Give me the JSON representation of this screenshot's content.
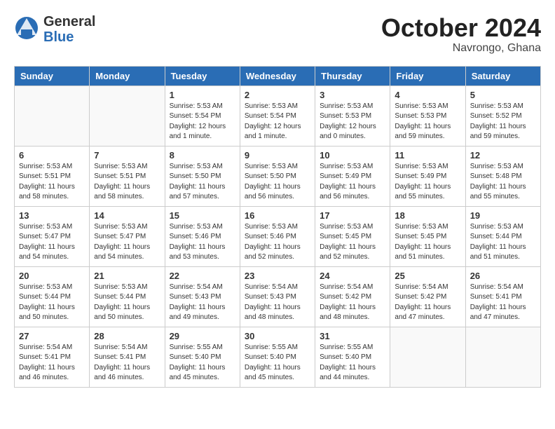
{
  "header": {
    "logo_general": "General",
    "logo_blue": "Blue",
    "month_title": "October 2024",
    "location": "Navrongo, Ghana"
  },
  "weekdays": [
    "Sunday",
    "Monday",
    "Tuesday",
    "Wednesday",
    "Thursday",
    "Friday",
    "Saturday"
  ],
  "weeks": [
    [
      {
        "day": "",
        "info": ""
      },
      {
        "day": "",
        "info": ""
      },
      {
        "day": "1",
        "info": "Sunrise: 5:53 AM\nSunset: 5:54 PM\nDaylight: 12 hours\nand 1 minute."
      },
      {
        "day": "2",
        "info": "Sunrise: 5:53 AM\nSunset: 5:54 PM\nDaylight: 12 hours\nand 1 minute."
      },
      {
        "day": "3",
        "info": "Sunrise: 5:53 AM\nSunset: 5:53 PM\nDaylight: 12 hours\nand 0 minutes."
      },
      {
        "day": "4",
        "info": "Sunrise: 5:53 AM\nSunset: 5:53 PM\nDaylight: 11 hours\nand 59 minutes."
      },
      {
        "day": "5",
        "info": "Sunrise: 5:53 AM\nSunset: 5:52 PM\nDaylight: 11 hours\nand 59 minutes."
      }
    ],
    [
      {
        "day": "6",
        "info": "Sunrise: 5:53 AM\nSunset: 5:51 PM\nDaylight: 11 hours\nand 58 minutes."
      },
      {
        "day": "7",
        "info": "Sunrise: 5:53 AM\nSunset: 5:51 PM\nDaylight: 11 hours\nand 58 minutes."
      },
      {
        "day": "8",
        "info": "Sunrise: 5:53 AM\nSunset: 5:50 PM\nDaylight: 11 hours\nand 57 minutes."
      },
      {
        "day": "9",
        "info": "Sunrise: 5:53 AM\nSunset: 5:50 PM\nDaylight: 11 hours\nand 56 minutes."
      },
      {
        "day": "10",
        "info": "Sunrise: 5:53 AM\nSunset: 5:49 PM\nDaylight: 11 hours\nand 56 minutes."
      },
      {
        "day": "11",
        "info": "Sunrise: 5:53 AM\nSunset: 5:49 PM\nDaylight: 11 hours\nand 55 minutes."
      },
      {
        "day": "12",
        "info": "Sunrise: 5:53 AM\nSunset: 5:48 PM\nDaylight: 11 hours\nand 55 minutes."
      }
    ],
    [
      {
        "day": "13",
        "info": "Sunrise: 5:53 AM\nSunset: 5:47 PM\nDaylight: 11 hours\nand 54 minutes."
      },
      {
        "day": "14",
        "info": "Sunrise: 5:53 AM\nSunset: 5:47 PM\nDaylight: 11 hours\nand 54 minutes."
      },
      {
        "day": "15",
        "info": "Sunrise: 5:53 AM\nSunset: 5:46 PM\nDaylight: 11 hours\nand 53 minutes."
      },
      {
        "day": "16",
        "info": "Sunrise: 5:53 AM\nSunset: 5:46 PM\nDaylight: 11 hours\nand 52 minutes."
      },
      {
        "day": "17",
        "info": "Sunrise: 5:53 AM\nSunset: 5:45 PM\nDaylight: 11 hours\nand 52 minutes."
      },
      {
        "day": "18",
        "info": "Sunrise: 5:53 AM\nSunset: 5:45 PM\nDaylight: 11 hours\nand 51 minutes."
      },
      {
        "day": "19",
        "info": "Sunrise: 5:53 AM\nSunset: 5:44 PM\nDaylight: 11 hours\nand 51 minutes."
      }
    ],
    [
      {
        "day": "20",
        "info": "Sunrise: 5:53 AM\nSunset: 5:44 PM\nDaylight: 11 hours\nand 50 minutes."
      },
      {
        "day": "21",
        "info": "Sunrise: 5:53 AM\nSunset: 5:44 PM\nDaylight: 11 hours\nand 50 minutes."
      },
      {
        "day": "22",
        "info": "Sunrise: 5:54 AM\nSunset: 5:43 PM\nDaylight: 11 hours\nand 49 minutes."
      },
      {
        "day": "23",
        "info": "Sunrise: 5:54 AM\nSunset: 5:43 PM\nDaylight: 11 hours\nand 48 minutes."
      },
      {
        "day": "24",
        "info": "Sunrise: 5:54 AM\nSunset: 5:42 PM\nDaylight: 11 hours\nand 48 minutes."
      },
      {
        "day": "25",
        "info": "Sunrise: 5:54 AM\nSunset: 5:42 PM\nDaylight: 11 hours\nand 47 minutes."
      },
      {
        "day": "26",
        "info": "Sunrise: 5:54 AM\nSunset: 5:41 PM\nDaylight: 11 hours\nand 47 minutes."
      }
    ],
    [
      {
        "day": "27",
        "info": "Sunrise: 5:54 AM\nSunset: 5:41 PM\nDaylight: 11 hours\nand 46 minutes."
      },
      {
        "day": "28",
        "info": "Sunrise: 5:54 AM\nSunset: 5:41 PM\nDaylight: 11 hours\nand 46 minutes."
      },
      {
        "day": "29",
        "info": "Sunrise: 5:55 AM\nSunset: 5:40 PM\nDaylight: 11 hours\nand 45 minutes."
      },
      {
        "day": "30",
        "info": "Sunrise: 5:55 AM\nSunset: 5:40 PM\nDaylight: 11 hours\nand 45 minutes."
      },
      {
        "day": "31",
        "info": "Sunrise: 5:55 AM\nSunset: 5:40 PM\nDaylight: 11 hours\nand 44 minutes."
      },
      {
        "day": "",
        "info": ""
      },
      {
        "day": "",
        "info": ""
      }
    ]
  ]
}
